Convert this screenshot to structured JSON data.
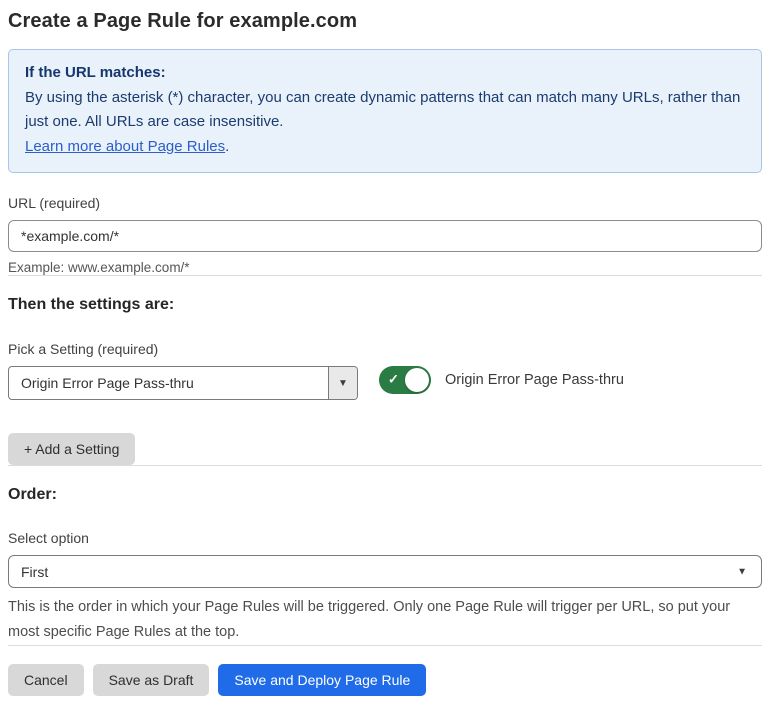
{
  "page": {
    "title": "Create a Page Rule for example.com"
  },
  "info_box": {
    "heading": "If the URL matches:",
    "body": "By using the asterisk (*) character, you can create dynamic patterns that can match many URLs, rather than just one. All URLs are case insensitive.",
    "link_label": "Learn more about Page Rules",
    "link_suffix": "."
  },
  "url_field": {
    "label": "URL (required)",
    "value": "*example.com/*",
    "helper": "Example: www.example.com/*"
  },
  "settings_section": {
    "heading": "Then the settings are:",
    "picker_label": "Pick a Setting (required)",
    "picker_value": "Origin Error Page Pass-thru",
    "toggle_state": "on",
    "toggle_label": "Origin Error Page Pass-thru",
    "add_button_label": "+ Add a Setting"
  },
  "order_section": {
    "heading": "Order:",
    "select_label": "Select option",
    "select_value": "First",
    "helper": "This is the order in which your Page Rules will be triggered. Only one Page Rule will trigger per URL, so put your most specific Page Rules at the top."
  },
  "footer": {
    "cancel_label": "Cancel",
    "save_draft_label": "Save as Draft",
    "save_deploy_label": "Save and Deploy Page Rule"
  },
  "icons": {
    "caret_down": "▼",
    "check": "✓"
  },
  "colors": {
    "accent_blue": "#1f6be8",
    "toggle_green": "#2b7b44",
    "info_bg": "#e9f1fb",
    "info_border": "#a9c6ea",
    "info_text": "#1b3c6e",
    "link_blue": "#2b5fc7"
  }
}
